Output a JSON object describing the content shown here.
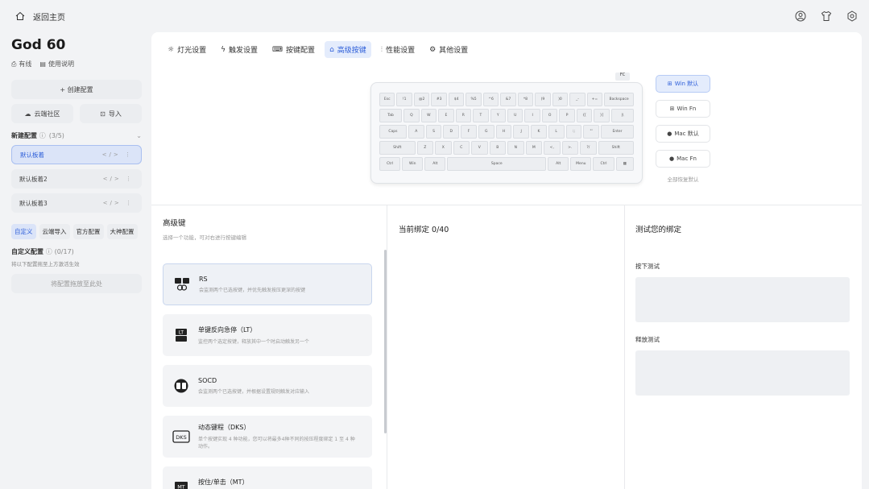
{
  "topbar": {
    "home_label": "返回主页",
    "icons": [
      "user-circle-icon",
      "shirt-icon",
      "settings-icon"
    ]
  },
  "sidebar": {
    "device_name": "God 60",
    "status": "有线",
    "manual": "使用说明",
    "create_label": "+ 创建配置",
    "cloud_label": "云端社区",
    "import_label": "导入",
    "new_profiles_label": "新建配置",
    "new_profiles_count": "(3/5)",
    "profiles": [
      {
        "name": "默认板着"
      },
      {
        "name": "默认板着2"
      },
      {
        "name": "默认板着3"
      }
    ],
    "tabs": [
      "自定义",
      "云端导入",
      "官方配置",
      "大神配置"
    ],
    "custom_title": "自定义配置",
    "custom_count": "(0/17)",
    "custom_hint": "将以下配置拖至上方激活生效",
    "drop_label": "将配置拖放至此处"
  },
  "tabs": [
    {
      "label": "灯光设置",
      "icon": "sun-icon"
    },
    {
      "label": "触发设置",
      "icon": "bolt-icon"
    },
    {
      "label": "按键配置",
      "icon": "keyboard-icon"
    },
    {
      "label": "高级按键",
      "icon": "lock-icon"
    },
    {
      "label": "性能设置",
      "icon": "sliders-icon"
    },
    {
      "label": "其他设置",
      "icon": "gear-icon"
    }
  ],
  "keyboard": {
    "tab_label": "FC",
    "rows": [
      [
        "Esc",
        "!1",
        "@2",
        "#3",
        "$4",
        "%5",
        "^6",
        "&7",
        "*8",
        "(9",
        ")0",
        "_-",
        "+=",
        "Backspace"
      ],
      [
        "Tab",
        "Q",
        "W",
        "E",
        "R",
        "T",
        "Y",
        "U",
        "I",
        "O",
        "P",
        "{[",
        "}]",
        "|\\"
      ],
      [
        "Caps",
        "A",
        "S",
        "D",
        "F",
        "G",
        "H",
        "J",
        "K",
        "L",
        ":;",
        "\"'",
        "Enter"
      ],
      [
        "Shift",
        "Z",
        "X",
        "C",
        "V",
        "B",
        "N",
        "M",
        "<,",
        ">.",
        "?/",
        "Shift"
      ],
      [
        "Ctrl",
        "Win",
        "Alt",
        "Space",
        "Alt",
        "Menu",
        "Ctrl",
        "▦"
      ]
    ]
  },
  "layouts": {
    "items": [
      {
        "label": "Win 默认",
        "icon": "windows-icon"
      },
      {
        "label": "Win Fn",
        "icon": "windows-icon"
      },
      {
        "label": "Mac 默认",
        "icon": "apple-icon"
      },
      {
        "label": "Mac Fn",
        "icon": "apple-icon"
      }
    ],
    "reset_label": "全部恢复默认"
  },
  "advanced": {
    "title": "高级键",
    "subtitle": "选择一个功能，可对右进行按键编辑",
    "cards": [
      {
        "title": "RS",
        "desc": "会监测两个已选按键，并优先触发按压更深的按键"
      },
      {
        "title": "单键反向急停（LT）",
        "desc": "监控两个选定按键，释放其中一个时启动触发另一个"
      },
      {
        "title": "SOCD",
        "desc": "会监测两个已选按键，并根据设置规则触发对应输入"
      },
      {
        "title": "动态键程（DKS）",
        "desc": "单个按键实现 4 种功能，您可以将最多4种不同的按压程度绑定 1 至 4 种动作。"
      },
      {
        "title": "按住/单击（MT）",
        "desc": ""
      }
    ]
  },
  "binding": {
    "title": "当前绑定 0/40"
  },
  "test": {
    "title": "测试您的绑定",
    "press_label": "按下测试",
    "release_label": "释放测试"
  }
}
